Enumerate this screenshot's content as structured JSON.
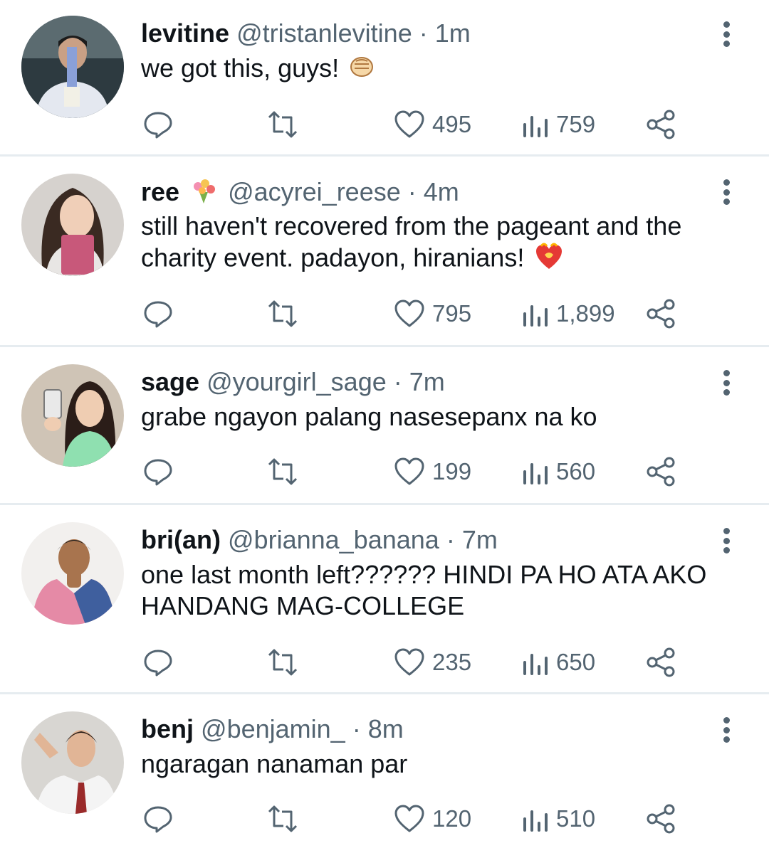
{
  "tweets": [
    {
      "name": "levitine",
      "handle": "@tristanlevitine",
      "time": "1m",
      "text": "we got this, guys!",
      "emoji": "fist-emoji",
      "likes": "495",
      "views": "759",
      "avatar": "person-white-shirt"
    },
    {
      "name": "ree",
      "name_emoji": "bouquet-emoji",
      "handle": "@acyrei_reese",
      "time": "4m",
      "text": "still haven't recovered from the pageant and the charity event. padayon, hiranians!",
      "emoji": "heart-on-fire-emoji",
      "likes": "795",
      "views": "1,899",
      "avatar": "woman-long-hair"
    },
    {
      "name": "sage",
      "handle": "@yourgirl_sage",
      "time": "7m",
      "text": "grabe ngayon palang nasesepanx na ko",
      "likes": "199",
      "views": "560",
      "avatar": "woman-selfie"
    },
    {
      "name": "bri(an)",
      "handle": "@brianna_banana",
      "time": "7m",
      "text": "one last month left?????? HINDI PA HO ATA AKO HANDANG MAG-COLLEGE",
      "likes": "235",
      "views": "650",
      "avatar": "man-pink-suit"
    },
    {
      "name": "benj",
      "handle": "@benjamin_",
      "time": "8m",
      "text": "ngaragan nanaman par",
      "likes": "120",
      "views": "510",
      "avatar": "man-tie"
    }
  ],
  "separator": "·",
  "colors": {
    "text": "#0f1419",
    "secondary": "#536471",
    "divider": "#e6ecf0"
  }
}
